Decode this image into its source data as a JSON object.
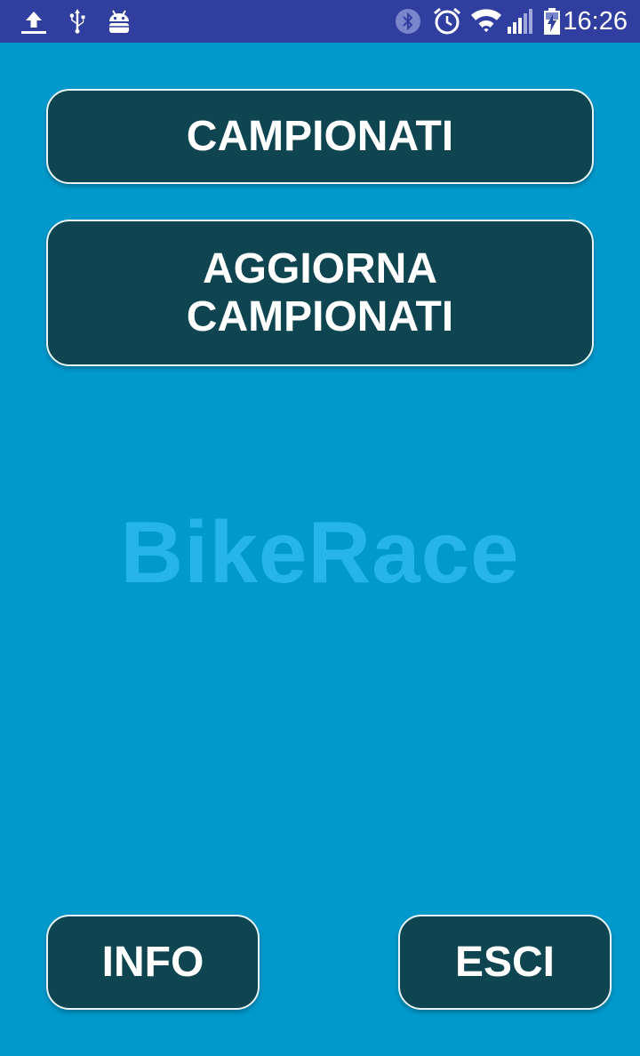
{
  "status_bar": {
    "time": "16:26",
    "icons": [
      "upload-icon",
      "usb-icon",
      "android-debug-icon",
      "bluetooth-icon",
      "alarm-icon",
      "wifi-icon",
      "signal-icon",
      "battery-charging-icon"
    ]
  },
  "main": {
    "campionati_label": "CAMPIONATI",
    "aggiorna_line1": "AGGIORNA",
    "aggiorna_line2": "CAMPIONATI",
    "watermark": "BikeRace"
  },
  "footer": {
    "info_label": "INFO",
    "esci_label": "ESCI"
  },
  "colors": {
    "background": "#0099CC",
    "status_bar": "#303F9F",
    "button_bg": "#0E4550",
    "watermark": "#26B5E8"
  }
}
